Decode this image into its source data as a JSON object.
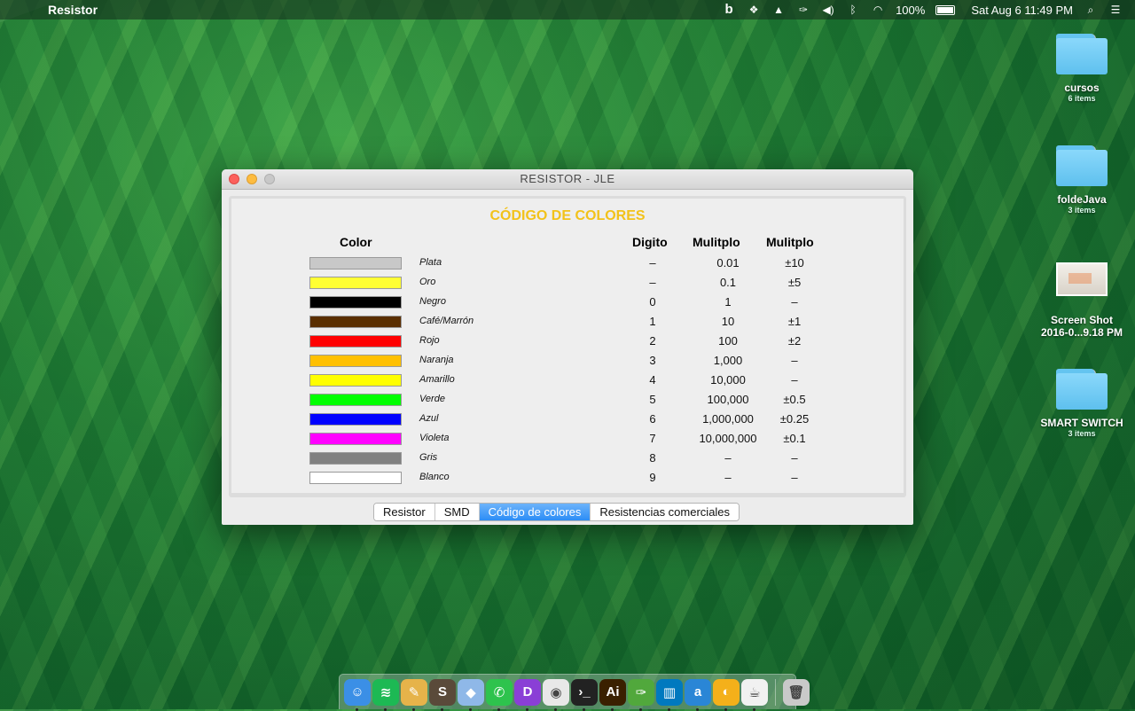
{
  "menubar": {
    "app_name": "Resistor",
    "battery_percent": "100%",
    "datetime": "Sat Aug 6  11:49 PM"
  },
  "desktop": [
    {
      "name": "cursos",
      "sub": "6 items"
    },
    {
      "name": "foldeJava",
      "sub": "3 items"
    },
    {
      "name": "Screen Shot",
      "sub": "2016-0...9.18 PM"
    },
    {
      "name": "SMART SWITCH",
      "sub": "3 items"
    }
  ],
  "window": {
    "title": "RESISTOR - JLE",
    "heading": "CÓDIGO DE COLORES",
    "columns": {
      "color": "Color",
      "digit": "Digito",
      "mult": "Mulitplo",
      "tol": "Mulitplo"
    },
    "rows": [
      {
        "name": "Plata",
        "color": "#c8c8c8",
        "digit": "–",
        "mult": "0.01",
        "tol": "±10"
      },
      {
        "name": "Oro",
        "color": "#ffff33",
        "digit": "–",
        "mult": "0.1",
        "tol": "±5"
      },
      {
        "name": "Negro",
        "color": "#000000",
        "digit": "0",
        "mult": "1",
        "tol": "–"
      },
      {
        "name": "Café/Marrón",
        "color": "#5a2e00",
        "digit": "1",
        "mult": "10",
        "tol": "±1"
      },
      {
        "name": "Rojo",
        "color": "#ff0000",
        "digit": "2",
        "mult": "100",
        "tol": "±2"
      },
      {
        "name": "Naranja",
        "color": "#ffc000",
        "digit": "3",
        "mult": "1,000",
        "tol": "–"
      },
      {
        "name": "Amarillo",
        "color": "#ffff00",
        "digit": "4",
        "mult": "10,000",
        "tol": "–"
      },
      {
        "name": "Verde",
        "color": "#00ff00",
        "digit": "5",
        "mult": "100,000",
        "tol": "±0.5"
      },
      {
        "name": "Azul",
        "color": "#0000ff",
        "digit": "6",
        "mult": "1,000,000",
        "tol": "±0.25"
      },
      {
        "name": "Violeta",
        "color": "#ff00ff",
        "digit": "7",
        "mult": "10,000,000",
        "tol": "±0.1"
      },
      {
        "name": "Gris",
        "color": "#808080",
        "digit": "8",
        "mult": "–",
        "tol": "–"
      },
      {
        "name": "Blanco",
        "color": "#ffffff",
        "digit": "9",
        "mult": "–",
        "tol": "–"
      }
    ],
    "tabs": [
      {
        "label": "Resistor",
        "active": false
      },
      {
        "label": "SMD",
        "active": false
      },
      {
        "label": "Código de colores",
        "active": true
      },
      {
        "label": "Resistencias comerciales",
        "active": false
      }
    ]
  },
  "dock": [
    {
      "name": "finder-icon",
      "bg": "#3b8fe6",
      "glyph": "☺"
    },
    {
      "name": "spotify-icon",
      "bg": "#1db954",
      "glyph": "≋"
    },
    {
      "name": "scrivener-icon",
      "bg": "#e6b34a",
      "glyph": "✎"
    },
    {
      "name": "sublime-icon",
      "bg": "#5a4a3a",
      "glyph": "S"
    },
    {
      "name": "virtualbox-icon",
      "bg": "#8fb8e8",
      "glyph": "◆"
    },
    {
      "name": "whatsapp-icon",
      "bg": "#2ec34d",
      "glyph": "✆"
    },
    {
      "name": "dash-icon",
      "bg": "#8a3fd6",
      "glyph": "D"
    },
    {
      "name": "chrome-icon",
      "bg": "#e8e8e8",
      "glyph": "◉"
    },
    {
      "name": "terminal-icon",
      "bg": "#222222",
      "glyph": "›_"
    },
    {
      "name": "illustrator-icon",
      "bg": "#3a2000",
      "glyph": "Ai"
    },
    {
      "name": "evernote-icon",
      "bg": "#51a83c",
      "glyph": "✑"
    },
    {
      "name": "trello-icon",
      "bg": "#0079bf",
      "glyph": "▥"
    },
    {
      "name": "app-a-icon",
      "bg": "#2a86d6",
      "glyph": "a"
    },
    {
      "name": "idea-icon",
      "bg": "#f4b01a",
      "glyph": "◐"
    },
    {
      "name": "java-icon",
      "bg": "#f1f1f1",
      "glyph": "☕"
    },
    {
      "name": "trash-icon",
      "bg": "#c9c9c9",
      "glyph": "🗑"
    }
  ]
}
